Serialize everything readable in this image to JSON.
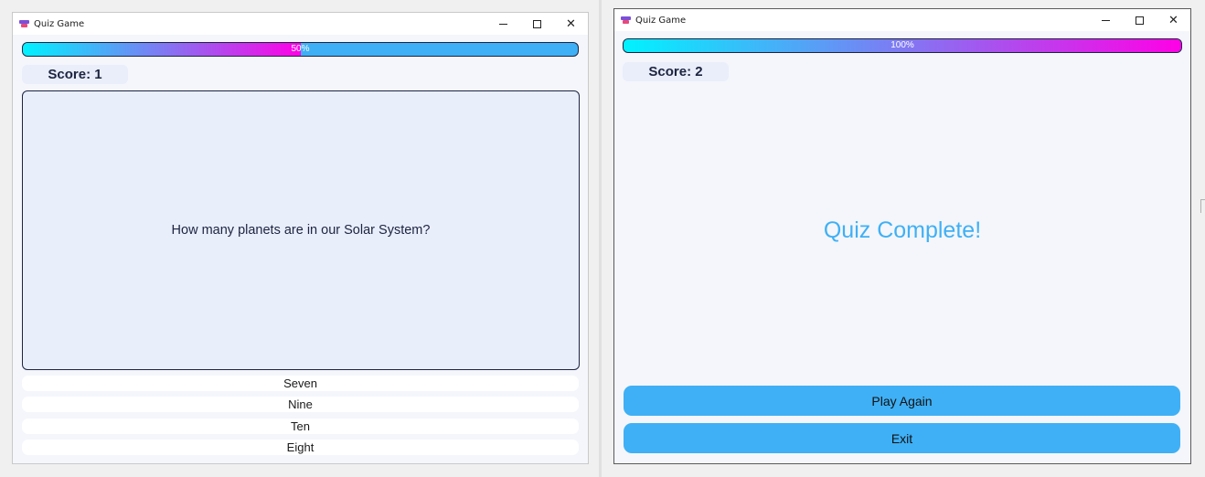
{
  "window1": {
    "title": "Quiz Game",
    "progress": {
      "fraction": 0.5,
      "label": "50%"
    },
    "score": "Score: 1",
    "question": "How many planets are in our Solar System?",
    "answers": [
      "Seven",
      "Nine",
      "Ten",
      "Eight"
    ]
  },
  "window2": {
    "title": "Quiz Game",
    "progress": {
      "fraction": 1.0,
      "label": "100%"
    },
    "score": "Score: 2",
    "message": "Quiz Complete!",
    "play_again": "Play Again",
    "exit": "Exit"
  },
  "colors": {
    "accent": "#3fb0f5",
    "progress_start": "#00f2ff",
    "progress_end": "#ff00e6",
    "dark": "#1d2440"
  },
  "icons": {
    "app": "quiz-app-icon",
    "minimize": "minimize-icon",
    "maximize": "maximize-icon",
    "close": "close-icon"
  }
}
